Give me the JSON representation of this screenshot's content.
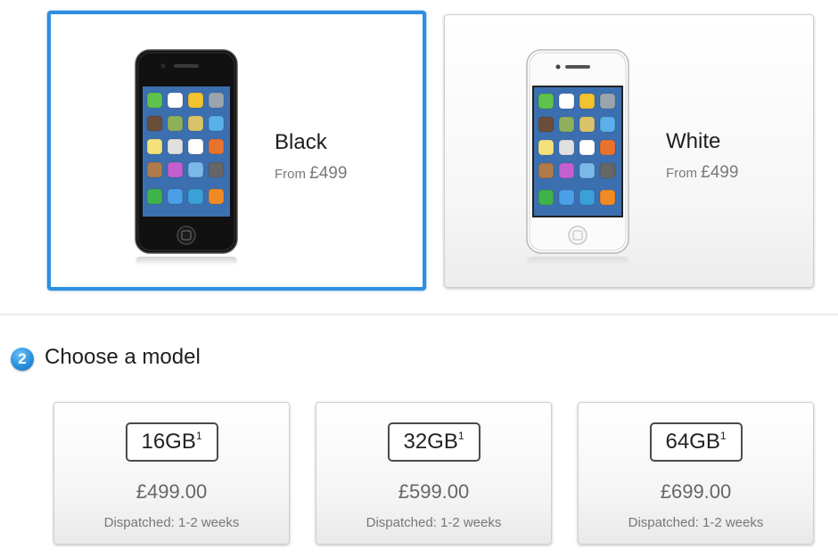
{
  "colors": [
    {
      "name": "Black",
      "from_label": "From",
      "price": "£499",
      "selected": true
    },
    {
      "name": "White",
      "from_label": "From",
      "price": "£499",
      "selected": false
    }
  ],
  "section": {
    "step": "2",
    "title": "Choose a model"
  },
  "models": [
    {
      "capacity": "16GB",
      "footnote": "1",
      "price": "£499.00",
      "dispatch": "Dispatched: 1-2 weeks"
    },
    {
      "capacity": "32GB",
      "footnote": "1",
      "price": "£599.00",
      "dispatch": "Dispatched: 1-2 weeks"
    },
    {
      "capacity": "64GB",
      "footnote": "1",
      "price": "£699.00",
      "dispatch": "Dispatched: 1-2 weeks"
    }
  ],
  "theme": {
    "accent": "#2e8fe0",
    "text": "#1e1e1e",
    "muted": "#7a7a7a"
  }
}
